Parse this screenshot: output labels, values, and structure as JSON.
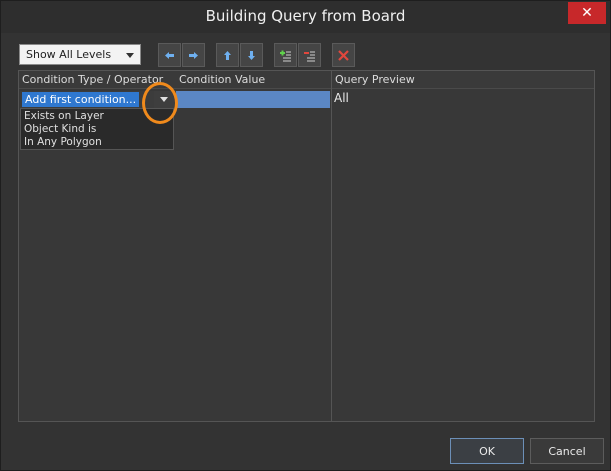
{
  "window": {
    "title": "Building Query from Board",
    "close_glyph": "✕"
  },
  "toolbar": {
    "level_dropdown": "Show All Levels",
    "buttons": [
      {
        "name": "move-left",
        "icon": "arrow-left-icon"
      },
      {
        "name": "move-right",
        "icon": "arrow-right-icon"
      },
      {
        "name": "move-up",
        "icon": "arrow-up-icon"
      },
      {
        "name": "move-down",
        "icon": "arrow-down-icon"
      },
      {
        "name": "add-condition",
        "icon": "add-row-icon"
      },
      {
        "name": "remove-condition",
        "icon": "remove-row-icon"
      },
      {
        "name": "delete",
        "icon": "red-x-icon"
      }
    ]
  },
  "grid": {
    "headers": {
      "condition_type": "Condition Type / Operator",
      "condition_value": "Condition Value",
      "query_preview": "Query Preview"
    },
    "row": {
      "condition": "Add first condition...",
      "preview": "All"
    },
    "options": [
      "Exists on Layer",
      "Object Kind is",
      "In Any Polygon"
    ]
  },
  "footer": {
    "ok": "OK",
    "cancel": "Cancel"
  },
  "colors": {
    "selection": "#2f78d0",
    "value_cell": "#5b87c4",
    "highlight": "#f08a1c",
    "close": "#c7282a"
  }
}
